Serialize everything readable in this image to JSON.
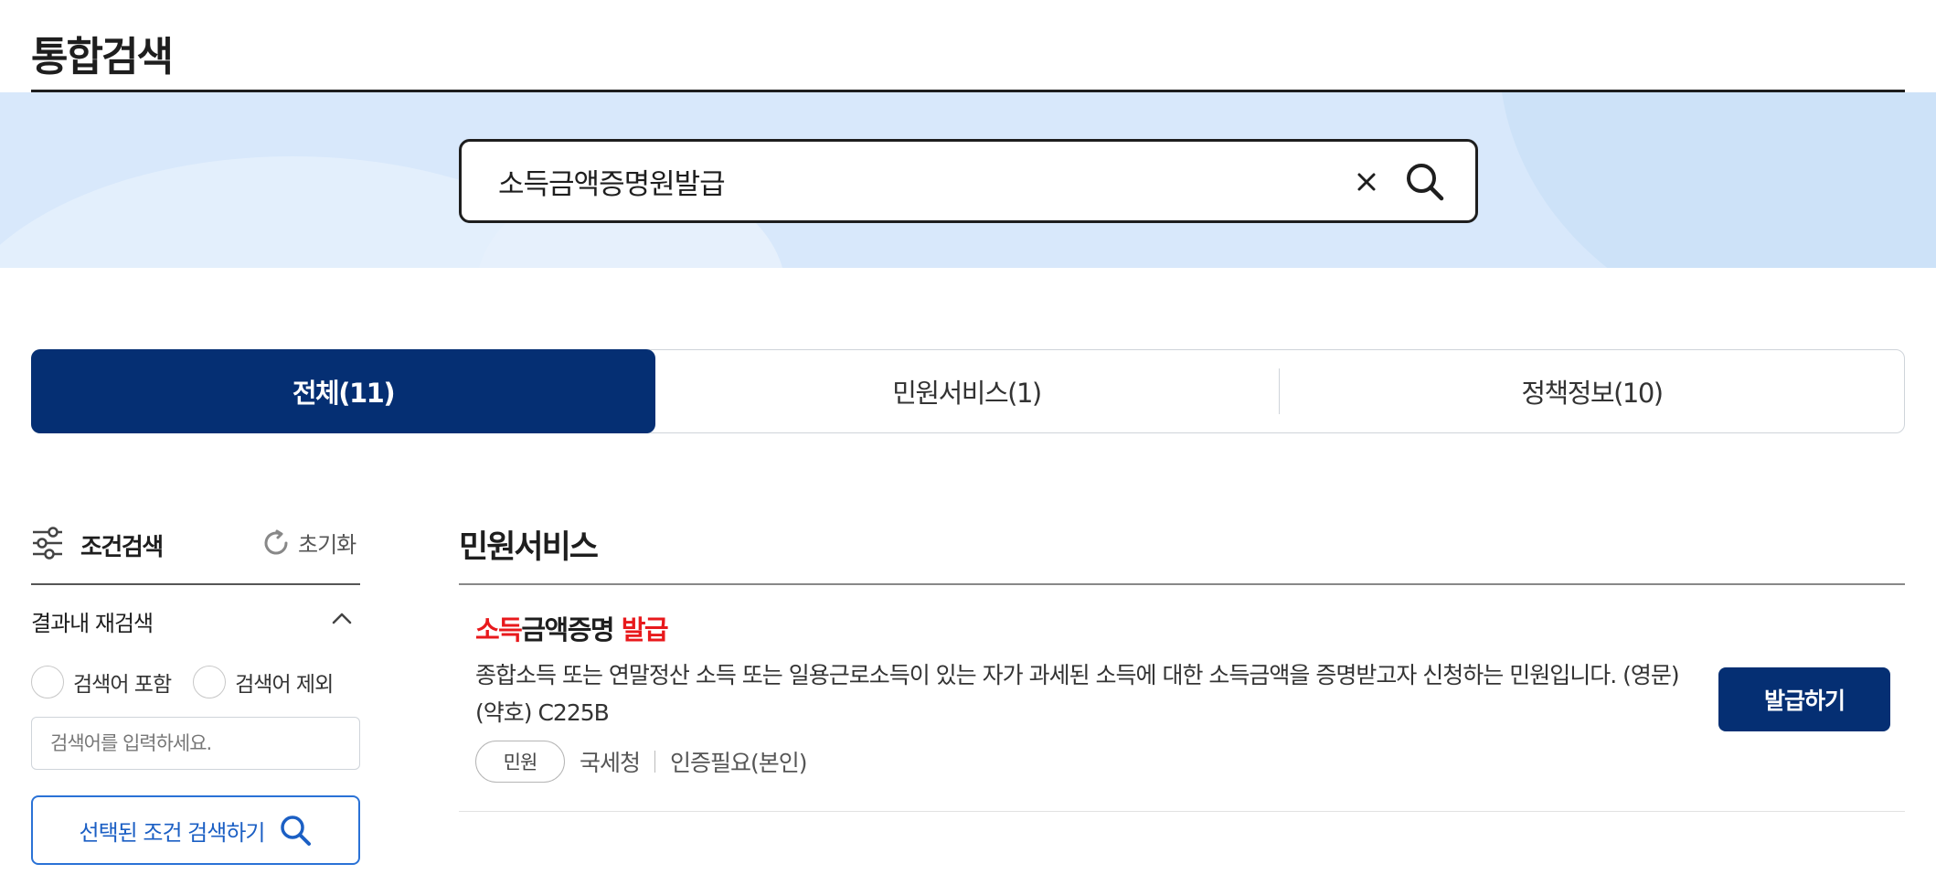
{
  "page": {
    "title": "통합검색"
  },
  "search": {
    "value": "소득금액증명원발급"
  },
  "tabs": [
    {
      "label": "전체(11)",
      "active": true
    },
    {
      "label": "민원서비스(1)",
      "active": false
    },
    {
      "label": "정책정보(10)",
      "active": false
    }
  ],
  "filter": {
    "title": "조건검색",
    "reset_label": "초기화",
    "refine_label": "결과내 재검색",
    "include_label": "검색어 포함",
    "exclude_label": "검색어 제외",
    "keyword_placeholder": "검색어를 입력하세요.",
    "apply_label": "선택된 조건 검색하기"
  },
  "results": {
    "section_title": "민원서비스",
    "items": [
      {
        "title_hl1": "소득",
        "title_mid": "금액증명 ",
        "title_hl2": "발급",
        "description": "종합소득 또는 연말정산 소득 또는 일용근로소득이 있는 자가 과세된 소득에 대한 소득금액을 증명받고자 신청하는 민원입니다. (영문)(약호) C225B",
        "badge": "민원",
        "agency": "국세청",
        "auth": "인증필요(본인)",
        "action_label": "발급하기"
      }
    ]
  },
  "colors": {
    "primary": "#052f73",
    "highlight": "#e8191c",
    "hero_bg": "#d8e8fb",
    "link_blue": "#1b5fc4"
  }
}
